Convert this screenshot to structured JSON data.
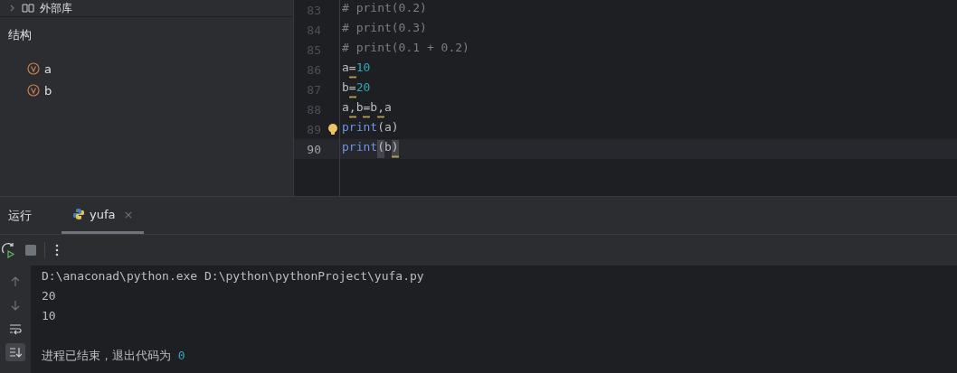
{
  "project_tree": {
    "items": [
      {
        "label": "外部库",
        "expanded": false
      }
    ]
  },
  "structure": {
    "title": "结构",
    "items": [
      {
        "name": "a"
      },
      {
        "name": "b"
      }
    ]
  },
  "editor": {
    "lines": [
      {
        "number": "83",
        "current": false,
        "intention": false,
        "tokens": [
          {
            "text": "# print(0.2)",
            "kind": "comment"
          }
        ]
      },
      {
        "number": "84",
        "current": false,
        "intention": false,
        "tokens": [
          {
            "text": "# print(0.3)",
            "kind": "comment"
          }
        ]
      },
      {
        "number": "85",
        "current": false,
        "intention": false,
        "tokens": [
          {
            "text": "# print(0.1 + 0.2)",
            "kind": "comment"
          }
        ]
      },
      {
        "number": "86",
        "current": false,
        "intention": false,
        "tokens": [
          {
            "text": "a",
            "kind": "plain"
          },
          {
            "text": "=",
            "kind": "plain",
            "warning": true
          },
          {
            "text": "10",
            "kind": "number"
          }
        ]
      },
      {
        "number": "87",
        "current": false,
        "intention": false,
        "tokens": [
          {
            "text": "b",
            "kind": "plain"
          },
          {
            "text": "=",
            "kind": "plain",
            "warning": true
          },
          {
            "text": "20",
            "kind": "number"
          }
        ]
      },
      {
        "number": "88",
        "current": false,
        "intention": false,
        "tokens": [
          {
            "text": "a",
            "kind": "plain"
          },
          {
            "text": ",",
            "kind": "plain",
            "warning": true
          },
          {
            "text": "b",
            "kind": "plain"
          },
          {
            "text": "=",
            "kind": "plain",
            "warning": true
          },
          {
            "text": "b",
            "kind": "plain"
          },
          {
            "text": ",",
            "kind": "plain",
            "warning": true
          },
          {
            "text": "a",
            "kind": "plain"
          }
        ]
      },
      {
        "number": "89",
        "current": false,
        "intention": true,
        "tokens": [
          {
            "text": "print",
            "kind": "builtin"
          },
          {
            "text": "(a)",
            "kind": "plain"
          }
        ]
      },
      {
        "number": "90",
        "current": true,
        "intention": false,
        "tokens": [
          {
            "text": "print",
            "kind": "builtin"
          },
          {
            "text": "(",
            "kind": "plain",
            "matched": true
          },
          {
            "text": "b",
            "kind": "plain"
          },
          {
            "text": ")",
            "kind": "plain",
            "matched": true,
            "warning": true
          }
        ]
      }
    ]
  },
  "run_panel": {
    "title": "运行",
    "tabs": [
      {
        "label": "yufa",
        "selected": true,
        "close": "×"
      }
    ],
    "gutter_tools": [
      {
        "kind": "up",
        "on": false
      },
      {
        "kind": "down",
        "on": false
      },
      {
        "kind": "soft-wrap",
        "on": false
      },
      {
        "kind": "scroll-to-end",
        "on": true
      }
    ],
    "console": [
      {
        "kind": "command",
        "tokens": [
          {
            "text": "D:\\anaconad\\python.exe D:\\python\\pythonProject\\yufa.py",
            "kind": "plain"
          }
        ]
      },
      {
        "kind": "output",
        "tokens": [
          {
            "text": "20",
            "kind": "plain"
          }
        ]
      },
      {
        "kind": "output",
        "tokens": [
          {
            "text": "10",
            "kind": "plain"
          }
        ]
      },
      {
        "kind": "status",
        "tokens": [
          {
            "text": "进程已结束，退出代码为 ",
            "kind": "plain"
          },
          {
            "text": "0",
            "kind": "number"
          }
        ]
      }
    ]
  }
}
